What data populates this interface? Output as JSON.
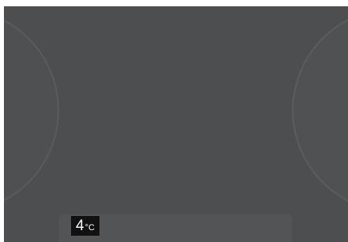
{
  "temperature": {
    "value": "4",
    "unit": "°C"
  },
  "colors": {
    "panel": "#4d4e50",
    "arc_stroke": "#5a5b5d",
    "label_bg": "#111111",
    "label_text": "#ffffff"
  }
}
